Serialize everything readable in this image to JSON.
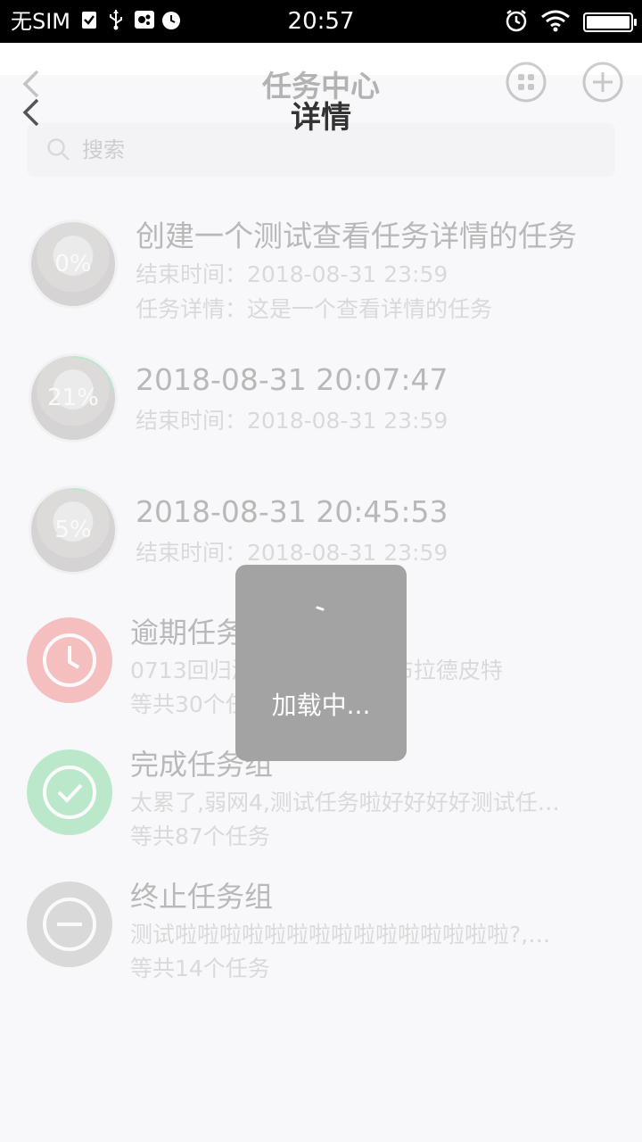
{
  "status_bar": {
    "carrier": "无SIM",
    "time": "20:57"
  },
  "background_page": {
    "title": "任务中心",
    "search": {
      "placeholder": "搜索"
    },
    "tasks": [
      {
        "title": "创建一个测试查看任务详情的任务",
        "percent": "0%",
        "progress": 0,
        "end_time": "结束时间：2018-08-31 23:59",
        "detail": "任务详情：这是一个查看详情的任务"
      },
      {
        "title": "2018-08-31 20:07:47",
        "percent": "21%",
        "progress": 0.21,
        "end_time": "结束时间：2018-08-31 23:59"
      },
      {
        "title": "2018-08-31 20:45:53",
        "percent": "5%",
        "progress": 0.05,
        "end_time": "结束时间：2018-08-31 23:59"
      }
    ],
    "groups": [
      {
        "title": "逾期任务组",
        "subtitle": "0713回归测试任务,ghhh,布拉德皮特",
        "count": "等共30个任务",
        "icon": "clock-icon",
        "color": "#f04a4a"
      },
      {
        "title": "完成任务组",
        "subtitle": "太累了,弱网4,测试任务啦好好好好测试任…",
        "count": "等共87个任务",
        "icon": "check-icon",
        "color": "#3ec76a"
      },
      {
        "title": "终止任务组",
        "subtitle": "测试啦啦啦啦啦啦啦啦啦啦啦啦啦啦啦?,…",
        "count": "等共14个任务",
        "icon": "minus-icon",
        "color": "#9a9a9a"
      }
    ]
  },
  "detail_header": {
    "title": "详情"
  },
  "loading": {
    "text": "加载中..."
  },
  "colors": {
    "progress_ring": "#3ec76a",
    "toast_bg": "#a3a3a3"
  }
}
